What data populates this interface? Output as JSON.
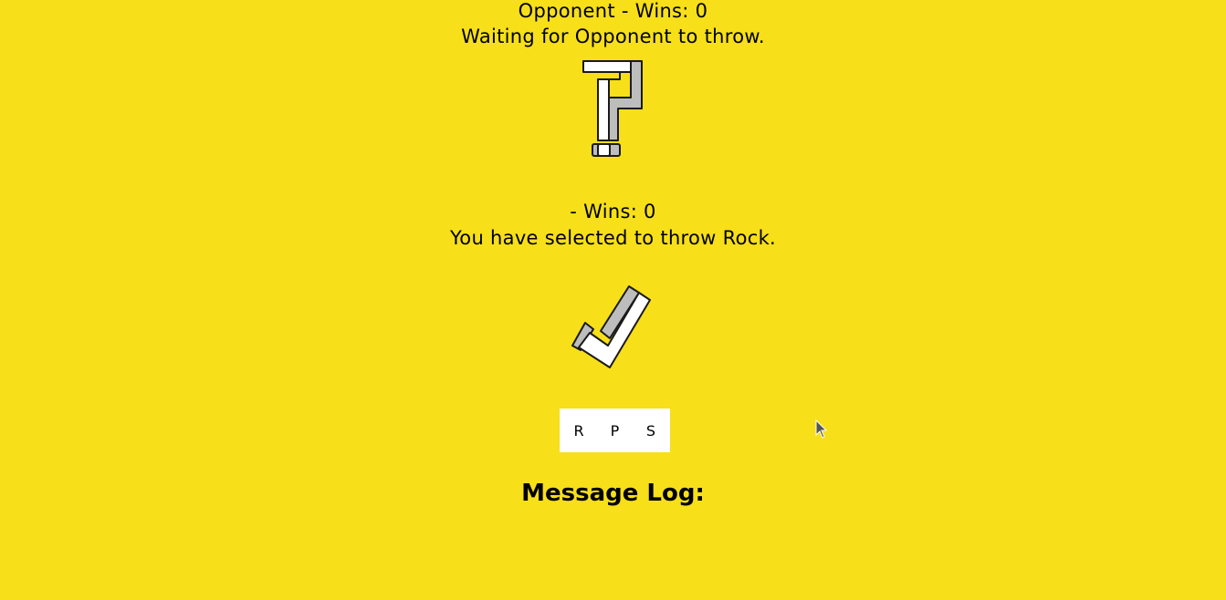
{
  "opponent": {
    "wins_text": "Opponent - Wins: 0",
    "status_text": "Waiting for Opponent to throw.",
    "icon": "question-mark-icon"
  },
  "player": {
    "wins_text": "- Wins: 0",
    "status_text": "You have selected to throw Rock.",
    "icon": "checkmark-icon"
  },
  "controls": {
    "rock_label": "R",
    "paper_label": "P",
    "scissors_label": "S"
  },
  "message_log": {
    "title": "Message Log:",
    "entries": []
  },
  "colors": {
    "background": "#f7df1a",
    "icon_fill": "#ffffff",
    "icon_shadow": "#bdbdbd",
    "icon_stroke": "#1a1a1a"
  }
}
